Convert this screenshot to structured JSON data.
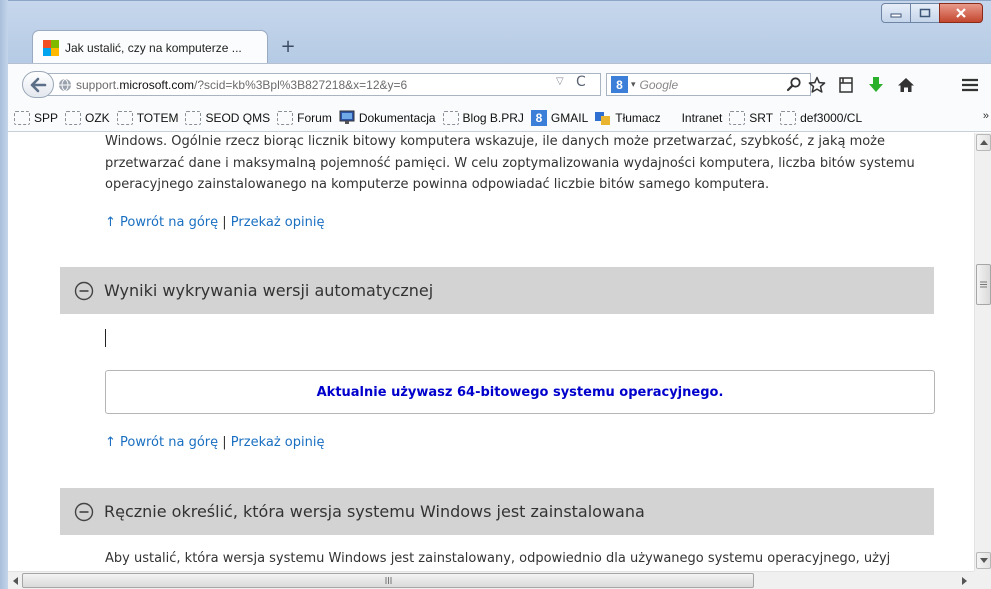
{
  "window": {
    "controls": [
      "minimize",
      "maximize",
      "close"
    ]
  },
  "tab": {
    "title": "Jak ustalić, czy na komputerze ...",
    "new_tab_label": "+"
  },
  "navbar": {
    "url_prefix": "support.",
    "url_domain": "microsoft.com",
    "url_suffix": "/?scid=kb%3Bpl%3B827218&x=12&y=6",
    "url_dropdown_glyph": "▽",
    "url_reload_glyph": "C",
    "search_engine_letter": "8",
    "search_placeholder": "Google"
  },
  "bookmarks": [
    {
      "label": "SPP",
      "icon": "folder-icon"
    },
    {
      "label": "OZK",
      "icon": "folder-icon"
    },
    {
      "label": "TOTEM",
      "icon": "folder-icon"
    },
    {
      "label": "SEOD QMS",
      "icon": "folder-icon"
    },
    {
      "label": "Forum",
      "icon": "folder-icon"
    },
    {
      "label": "Dokumentacja",
      "icon": "monitor-icon"
    },
    {
      "label": "Blog B.PRJ",
      "icon": "folder-icon"
    },
    {
      "label": "GMAIL",
      "icon": "search-8-icon"
    },
    {
      "label": "Tłumacz",
      "icon": "translate-icon"
    },
    {
      "label": "Intranet",
      "icon": "none"
    },
    {
      "label": "SRT",
      "icon": "folder-icon"
    },
    {
      "label": "def3000/CL",
      "icon": "folder-icon"
    }
  ],
  "bookmarks_overflow": "»",
  "content": {
    "intro_paragraph": "Windows. Ogólnie rzecz biorąc licznik bitowy komputera wskazuje, ile danych może przetwarzać, szybkość, z jaką może przetwarzać dane i maksymalną pojemność pamięci. W celu zoptymalizowania wydajności komputera, liczba bitów systemu operacyjnego zainstalowanego na komputerze powinna odpowiadać liczbie bitów samego komputera.",
    "back_to_top": "↑ Powrót na górę",
    "separator": "|",
    "feedback": "Przekaż opinię",
    "section1_title": "Wyniki wykrywania wersji automatycznej",
    "result_text": "Aktualnie używasz 64-bitowego systemu operacyjnego.",
    "section2_title": "Ręcznie określić, która wersja systemu Windows jest zainstalowana",
    "section2_paragraph": "Aby ustalić, która wersja systemu Windows jest zainstalowany, odpowiednio dla używanego systemu operacyjnego, użyj"
  },
  "colors": {
    "link": "#1a6fc1",
    "result_text": "#0000cc",
    "section_bar": "#d3d3d3",
    "body_text": "#333333"
  }
}
